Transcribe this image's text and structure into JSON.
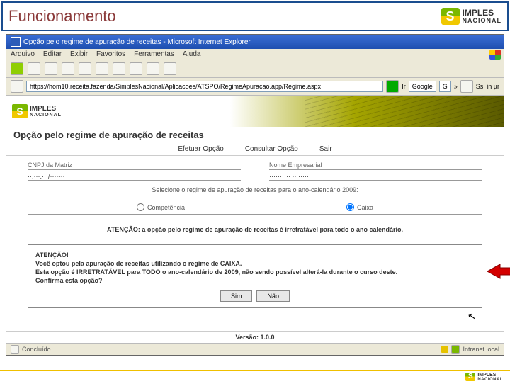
{
  "slide": {
    "title": "Funcionamento"
  },
  "logo": {
    "brand": "IMPLES",
    "sub": "NACIONAL"
  },
  "ie": {
    "title": "Opção pelo regime de apuração de receitas - Microsoft Internet Explorer",
    "menu": {
      "arquivo": "Arquivo",
      "editar": "Editar",
      "exibir": "Exibir",
      "favoritos": "Favoritos",
      "ferramentas": "Ferramentas",
      "ajuda": "Ajuda"
    },
    "url": "https://hom10.receita.fazenda/SimplesNacional/Aplicacoes/ATSPO/RegimeApuracao.app/Regime.aspx",
    "go": "Ir",
    "google": "Google",
    "g": "G",
    "links": "Ss: in µr",
    "status_left": "Concluído",
    "status_right": "Intranet local"
  },
  "page": {
    "heading": "Opção pelo regime de apuração de receitas",
    "tabs": {
      "efetuar": "Efetuar Opção",
      "consultar": "Consultar Opção",
      "sair": "Sair"
    },
    "fields": {
      "cnpj_label": "CNPJ da Matriz",
      "cnpj_value": "··.···.···/····-··",
      "nome_label": "Nome Empresarial",
      "nome_value": "·········· ·· ·······"
    },
    "question": "Selecione o regime de apuração de receitas para o ano-calendário 2009:",
    "radios": {
      "competencia": "Competência",
      "caixa": "Caixa"
    },
    "attention": "ATENÇÃO: a opção pelo regime de apuração de receitas é irretratável para todo o ano calendário.",
    "confirm": {
      "head": "ATENÇÃO!",
      "l1": "Você optou pela apuração de receitas utilizando o regime de CAIXA.",
      "l2": "Esta opção é IRRETRATÁVEL para TODO o ano-calendário de 2009, não sendo possível alterá-la durante o curso deste.",
      "l3": "Confirma esta opção?",
      "sim": "Sim",
      "nao": "Não"
    },
    "version": "Versão: 1.0.0"
  }
}
